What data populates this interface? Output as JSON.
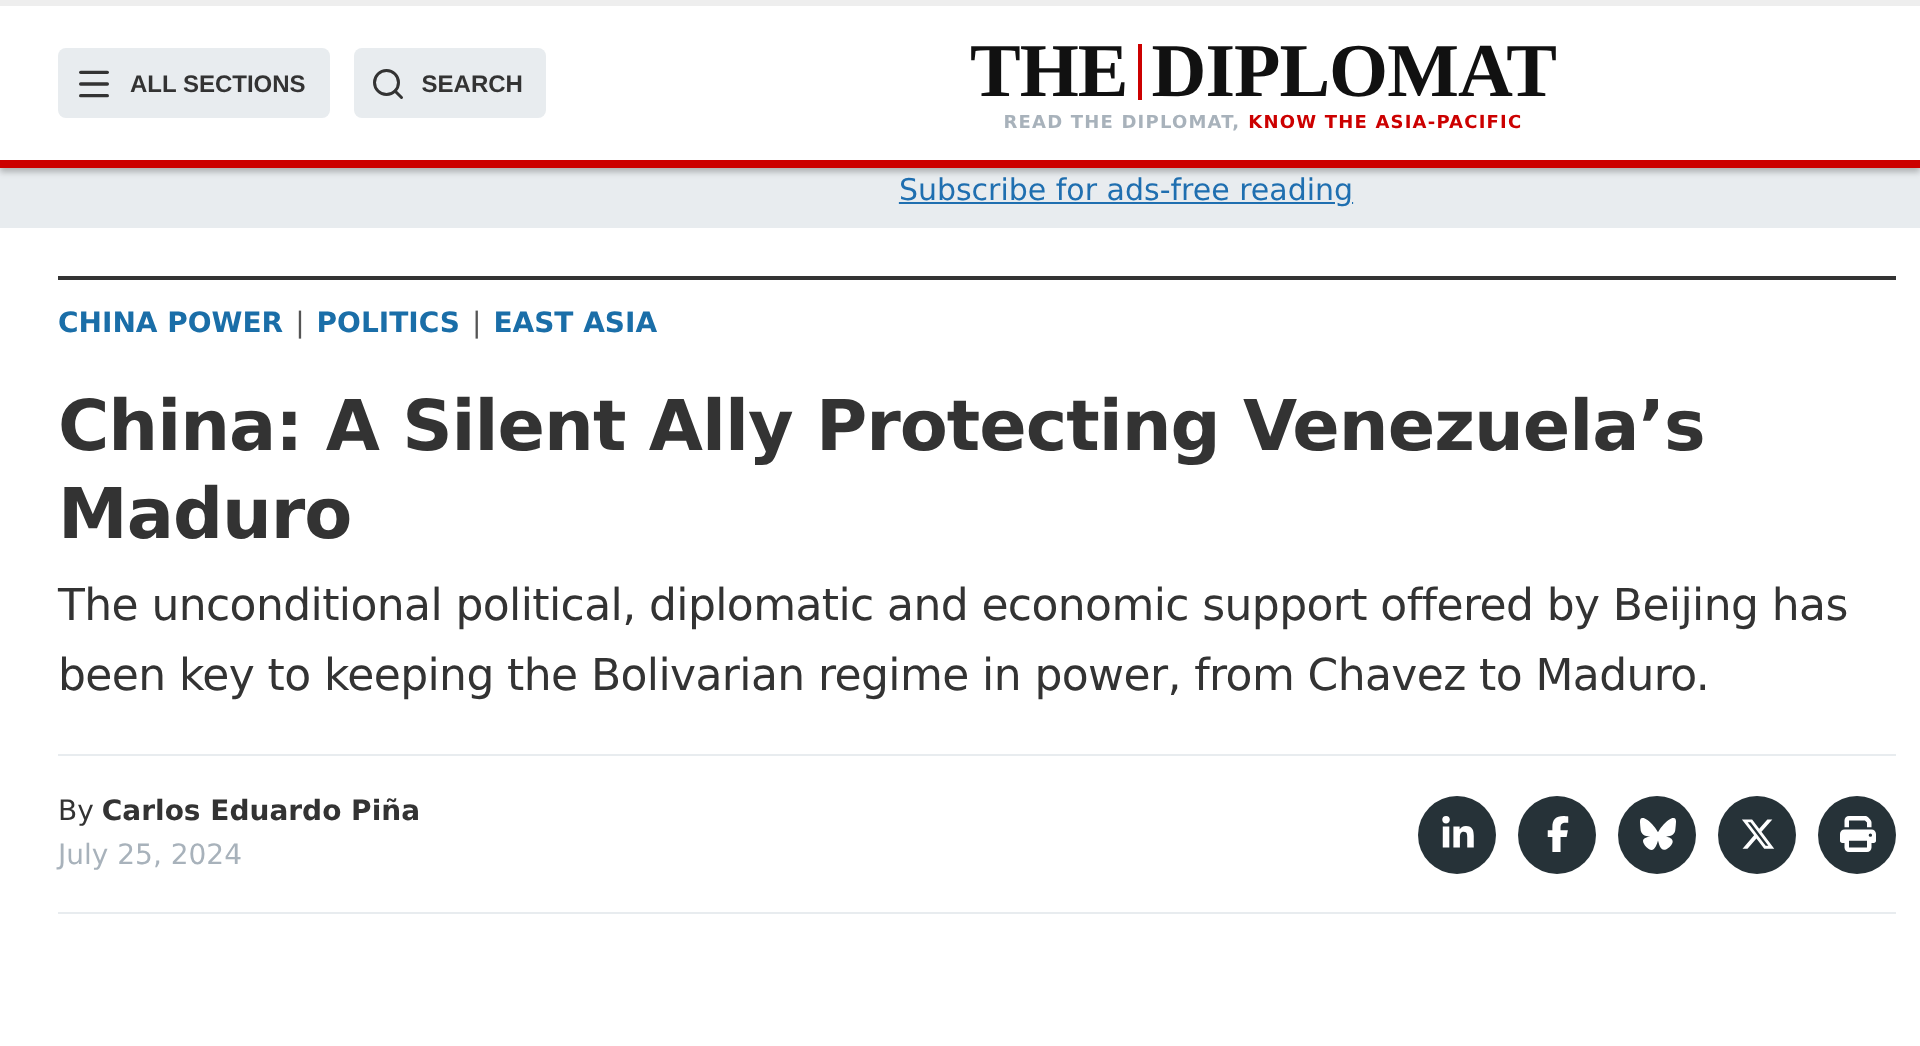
{
  "header": {
    "buttons": [
      {
        "kind": "menu",
        "label": "ALL SECTIONS"
      },
      {
        "kind": "search",
        "label": "SEARCH"
      }
    ],
    "logo": {
      "left": "THE",
      "right": "DIPLOMAT",
      "tagline_muted": "READ THE DIPLOMAT,",
      "tagline_accent": "KNOW THE ASIA-PACIFIC"
    }
  },
  "subscribe_link": "Subscribe for ads-free reading",
  "article": {
    "categories": [
      "CHINA POWER",
      "POLITICS",
      "EAST ASIA"
    ],
    "category_separator": "|",
    "title": "China: A Silent Ally Protecting Venezuela’s Maduro",
    "subtitle": "The unconditional political, diplomatic and economic support offered by Beijing has been key to keeping the Bolivarian regime in power, from Chavez to Maduro.",
    "byline_prefix": "By",
    "author": "Carlos Eduardo Piña",
    "date": "July 25, 2024",
    "share": [
      {
        "kind": "linkedin"
      },
      {
        "kind": "facebook"
      },
      {
        "kind": "bluesky"
      },
      {
        "kind": "x"
      },
      {
        "kind": "print"
      }
    ]
  }
}
